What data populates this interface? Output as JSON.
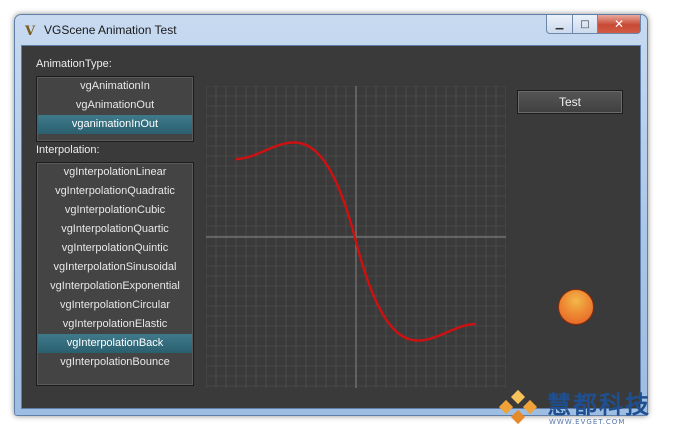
{
  "window": {
    "title": "VGScene Animation Test",
    "icon": "vgscene-app-icon",
    "controls": {
      "minimize": "minimize-icon",
      "maximize": "maximize-icon",
      "close": "close-icon"
    }
  },
  "animation_type": {
    "label": "AnimationType:",
    "items": [
      "vgAnimationIn",
      "vgAnimationOut",
      "vganimationInOut"
    ],
    "selected": "vganimationInOut"
  },
  "interpolation": {
    "label": "Interpolation:",
    "items": [
      "vgInterpolationLinear",
      "vgInterpolationQuadratic",
      "vgInterpolationCubic",
      "vgInterpolationQuartic",
      "vgInterpolationQuintic",
      "vgInterpolationSinusoidal",
      "vgInterpolationExponential",
      "vgInterpolationCircular",
      "vgInterpolationElastic",
      "vgInterpolationBack",
      "vgInterpolationBounce"
    ],
    "selected": "vgInterpolationBack"
  },
  "test_button": {
    "label": "Test"
  },
  "curve": {
    "color": "#d01010",
    "grid_color": "#555555",
    "axis_color": "#7a7a7a"
  },
  "ball": {
    "color": "#ee8a33"
  },
  "watermark": {
    "text": "慧都科技",
    "sub": "WWW.EVGET.COM"
  },
  "colors": {
    "selection": "#2f6b7c",
    "background": "#3a3a3a"
  }
}
